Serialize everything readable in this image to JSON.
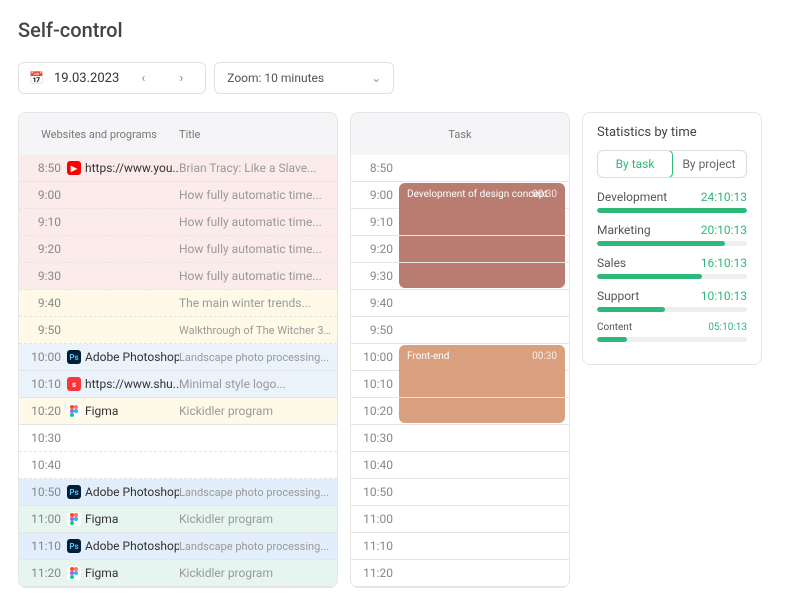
{
  "page_title": "Self-control",
  "date": "19.03.2023",
  "zoom_label": "Zoom: 10 minutes",
  "panel1_headers": {
    "c1": "Websites and programs",
    "c2": "Title"
  },
  "panel2_header": "Task",
  "rows": [
    {
      "t": "8:50",
      "ws": "https://www.you...",
      "title": "Brian Tracy: Like a Slave...",
      "bg": "bg-red",
      "icon": "yt"
    },
    {
      "t": "9:00",
      "ws": "",
      "title": "How fully automatic time...",
      "bg": "bg-red"
    },
    {
      "t": "9:10",
      "ws": "",
      "title": "How fully automatic time...",
      "bg": "bg-red"
    },
    {
      "t": "9:20",
      "ws": "",
      "title": "How fully automatic time...",
      "bg": "bg-red"
    },
    {
      "t": "9:30",
      "ws": "",
      "title": "How fully automatic time...",
      "bg": "bg-red"
    },
    {
      "t": "9:40",
      "ws": "",
      "title": "The main winter trends...",
      "bg": "bg-ylw"
    },
    {
      "t": "9:50",
      "ws": "",
      "title": "Walkthrough of The Witcher 3...",
      "bg": "bg-ylw",
      "small": true
    },
    {
      "t": "10:00",
      "ws": "Adobe Photoshop",
      "title": "Landscape photo processing...",
      "bg": "bg-blue",
      "icon": "ps",
      "small": true
    },
    {
      "t": "10:10",
      "ws": "https://www.shu...",
      "title": "Minimal style logo...",
      "bg": "bg-blue",
      "icon": "sh"
    },
    {
      "t": "10:20",
      "ws": "Figma",
      "title": "Kickidler program",
      "bg": "bg-ylw",
      "icon": "fg"
    },
    {
      "t": "10:30",
      "ws": "",
      "title": ""
    },
    {
      "t": "10:40",
      "ws": "",
      "title": ""
    },
    {
      "t": "10:50",
      "ws": "Adobe Photoshop",
      "title": "Landscape photo processing...",
      "bg": "bg-blue2",
      "icon": "ps",
      "small": true
    },
    {
      "t": "11:00",
      "ws": "Figma",
      "title": "Kickidler program",
      "bg": "bg-grn",
      "icon": "fg"
    },
    {
      "t": "11:10",
      "ws": "Adobe Photoshop",
      "title": "Landscape photo processing...",
      "bg": "bg-blue2",
      "icon": "ps",
      "small": true
    },
    {
      "t": "11:20",
      "ws": "Figma",
      "title": "Kickidler program",
      "bg": "bg-grn",
      "icon": "fg"
    }
  ],
  "times2": [
    "8:50",
    "9:00",
    "9:10",
    "9:20",
    "9:30",
    "9:40",
    "9:50",
    "10:00",
    "10:10",
    "10:20",
    "10:30",
    "10:40",
    "10:50",
    "11:00",
    "11:10",
    "11:20"
  ],
  "tasks": [
    {
      "name": "Development of design concept",
      "dur": "00:30",
      "cls": "tb1",
      "at": 1
    },
    {
      "name": "Front-end",
      "dur": "00:30",
      "cls": "tb2",
      "at": 7
    }
  ],
  "panel3_title": "Statistics by time",
  "tabs": {
    "a": "By task",
    "b": "By project"
  },
  "stats": [
    {
      "name": "Development",
      "val": "24:10:13",
      "pct": 100
    },
    {
      "name": "Marketing",
      "val": "20:10:13",
      "pct": 85
    },
    {
      "name": "Sales",
      "val": "16:10:13",
      "pct": 70
    },
    {
      "name": "Support",
      "val": "10:10:13",
      "pct": 45
    },
    {
      "name": "Content",
      "val": "05:10:13",
      "pct": 20,
      "small": true
    }
  ]
}
